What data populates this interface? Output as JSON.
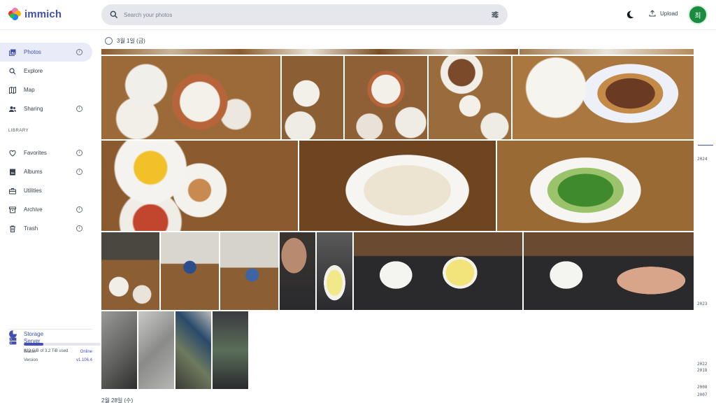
{
  "app": {
    "name": "immich"
  },
  "header": {
    "search_placeholder": "Search your photos",
    "upload_label": "Upload",
    "avatar_initial": "최"
  },
  "sidebar": {
    "items": [
      {
        "label": "Photos",
        "icon": "photos-icon",
        "active": true,
        "info": true
      },
      {
        "label": "Explore",
        "icon": "search-icon",
        "active": false,
        "info": false
      },
      {
        "label": "Map",
        "icon": "map-icon",
        "active": false,
        "info": false
      },
      {
        "label": "Sharing",
        "icon": "people-icon",
        "active": false,
        "info": true
      }
    ],
    "library_title": "LIBRARY",
    "library_items": [
      {
        "label": "Favorites",
        "icon": "heart-icon",
        "info": true
      },
      {
        "label": "Albums",
        "icon": "album-icon",
        "info": true
      },
      {
        "label": "Utilities",
        "icon": "toolbox-icon",
        "info": false
      },
      {
        "label": "Archive",
        "icon": "archive-icon",
        "info": true
      },
      {
        "label": "Trash",
        "icon": "trash-icon",
        "info": true
      }
    ],
    "storage": {
      "title": "Storage",
      "used_text": "822 GiB of 3.2 TiB used",
      "used_fraction": 0.25
    },
    "server": {
      "title": "Server",
      "status_label": "Status",
      "status_value": "Online",
      "version_label": "Version",
      "version_value": "v1.106.4"
    }
  },
  "timeline": {
    "date_group_1": "3월 1일 (금)",
    "date_group_2": "2월 28일 (수)",
    "photos_count_row": 4,
    "year_labels": [
      "2024",
      "2023",
      "2022",
      "2018",
      "2008",
      "2007"
    ]
  },
  "colors": {
    "accent": "#4250af",
    "avatar_bg": "#1b8b3f",
    "wood": "#8a5a2c",
    "plate": "#f2f1ec"
  }
}
